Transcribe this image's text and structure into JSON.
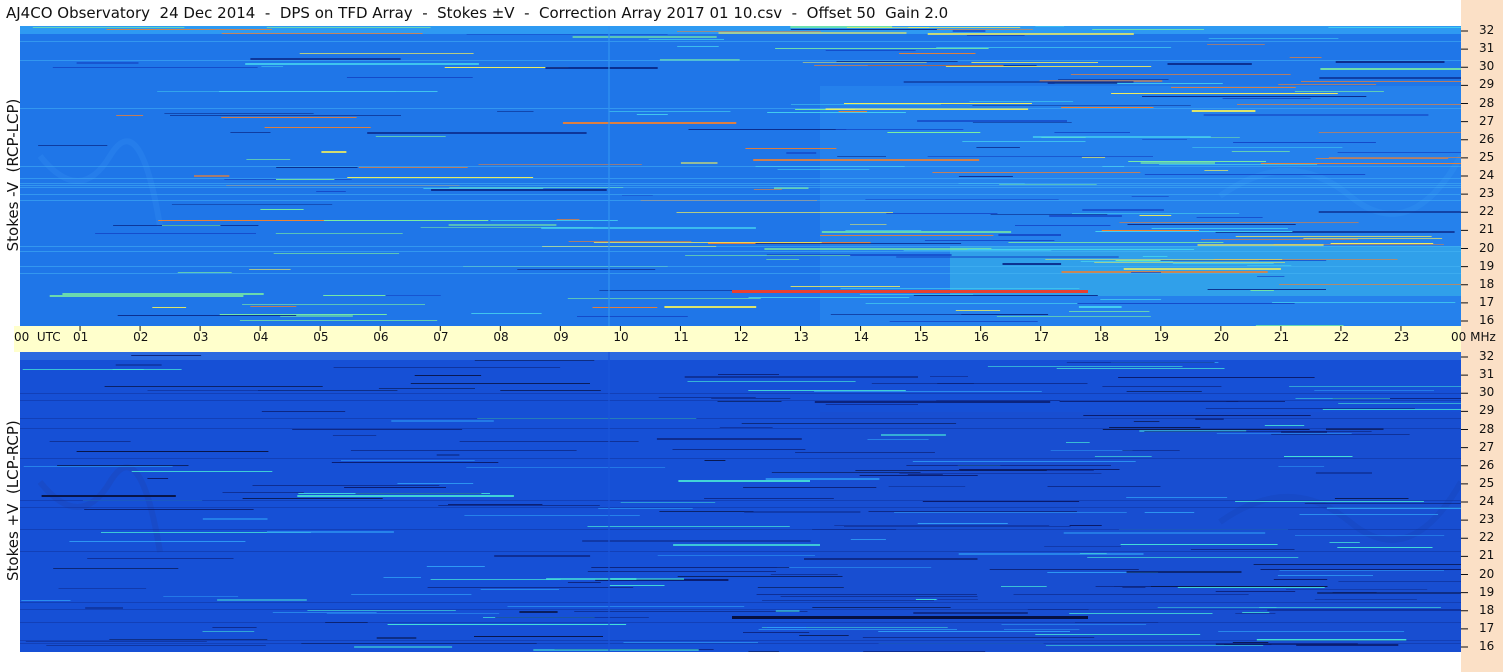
{
  "title": "AJ4CO Observatory  24 Dec 2014  -  DPS on TFD Array  -  Stokes ±V  -  Correction Array 2017 01 10.csv  -  Offset 50  Gain 2.0",
  "colors": {
    "frame": "#ffffff",
    "time_strip": "#ffffcc",
    "freq_strip": "#fbe0c6",
    "top_base": "#1f76e8",
    "bottom_base": "#1650d6"
  },
  "chart_data": [
    {
      "type": "heatmap",
      "ylabel": "Stokes -V  (RCP-LCP)",
      "x_range_utc_hours": [
        0,
        24
      ],
      "y_range_mhz": [
        16,
        32
      ],
      "y_ticks": [
        "32",
        "31",
        "30",
        "29",
        "28",
        "27",
        "26",
        "25",
        "24",
        "23",
        "22",
        "21",
        "20",
        "19",
        "18",
        "17",
        "16"
      ],
      "colormap": "jet-like",
      "legend": "none"
    },
    {
      "type": "heatmap",
      "ylabel": "Stokes +V  (LCP-RCP)",
      "x_range_utc_hours": [
        0,
        24
      ],
      "y_range_mhz": [
        16,
        32
      ],
      "y_ticks": [
        "32",
        "31",
        "30",
        "29",
        "28",
        "27",
        "26",
        "25",
        "24",
        "23",
        "22",
        "21",
        "20",
        "19",
        "18",
        "17",
        "16"
      ],
      "colormap": "jet-like",
      "legend": "none"
    }
  ],
  "time_axis": {
    "first_label": "00  UTC",
    "labels": [
      "01",
      "02",
      "03",
      "04",
      "05",
      "06",
      "07",
      "08",
      "09",
      "10",
      "11",
      "12",
      "13",
      "14",
      "15",
      "16",
      "17",
      "18",
      "19",
      "20",
      "21",
      "22",
      "23"
    ],
    "last_label": "00 MHz"
  }
}
